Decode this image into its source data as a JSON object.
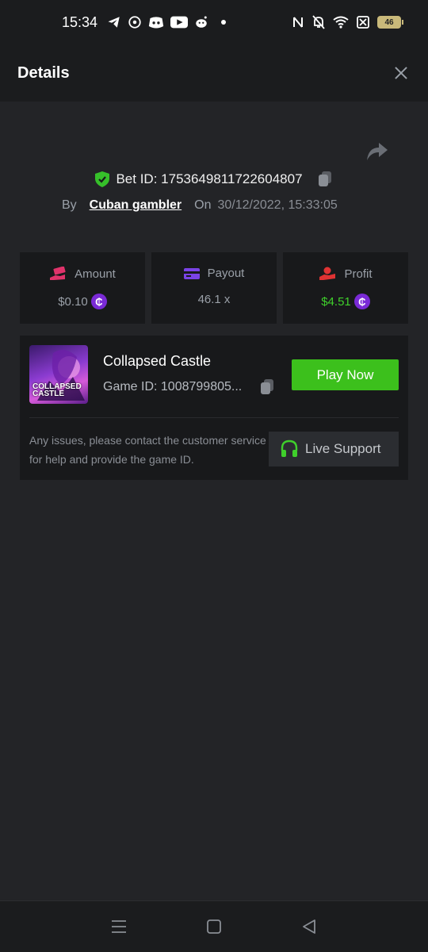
{
  "status_bar": {
    "time": "15:34",
    "apps": [
      "telegram-icon",
      "whatsapp-icon",
      "discord-icon",
      "youtube-icon",
      "reddit-icon"
    ],
    "battery": "46"
  },
  "header": {
    "title": "Details"
  },
  "bet": {
    "id_label": "Bet ID: 1753649811722604807",
    "by_label": "By",
    "user": "Cuban gambler",
    "on_label": "On",
    "datetime": "30/12/2022, 15:33:05"
  },
  "stats": {
    "amount": {
      "label": "Amount",
      "value": "$0.10",
      "color": "#e0336b"
    },
    "payout": {
      "label": "Payout",
      "value": "46.1 x",
      "color": "#7a43e6"
    },
    "profit": {
      "label": "Profit",
      "value": "$4.51",
      "color": "#e03333",
      "value_color": "#3fcf2b"
    }
  },
  "coin_symbol": "₵",
  "game": {
    "thumb_text": "COLLAPSED CASTLE",
    "name": "Collapsed Castle",
    "id_label": "Game ID: 1008799805...",
    "play_label": "Play Now"
  },
  "support": {
    "text": "Any issues, please contact the customer service for help and provide the game ID.",
    "button_label": "Live Support"
  },
  "colors": {
    "accent_green": "#3cc01c",
    "coin_purple": "#7a2ad6"
  }
}
